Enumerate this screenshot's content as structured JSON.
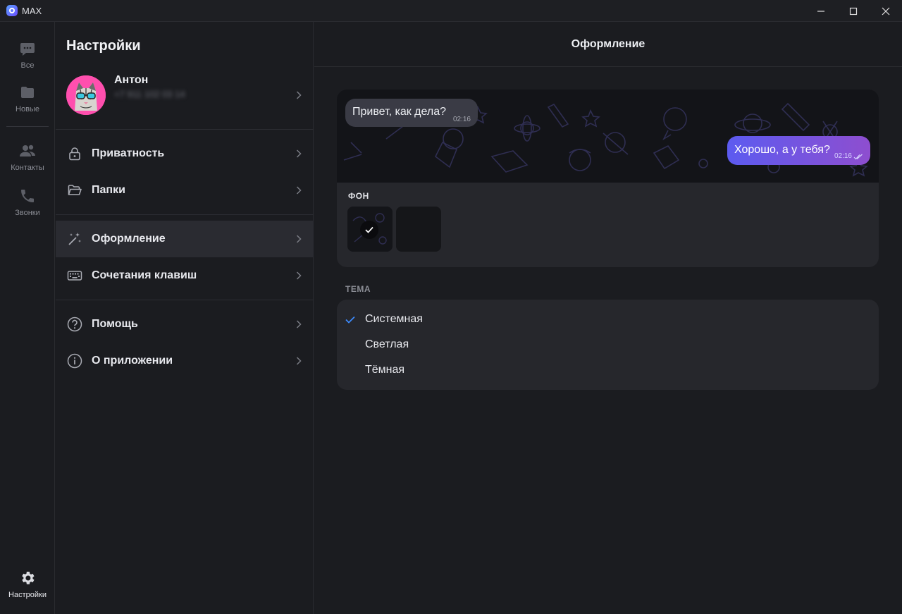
{
  "window": {
    "title": "MAX"
  },
  "rail": {
    "items": [
      {
        "label": "Все",
        "icon": "chat-icon"
      },
      {
        "label": "Новые",
        "icon": "folder-icon"
      },
      {
        "label": "Контакты",
        "icon": "contacts-icon"
      },
      {
        "label": "Звонки",
        "icon": "phone-icon"
      }
    ],
    "settings_label": "Настройки"
  },
  "settings": {
    "title": "Настройки",
    "profile": {
      "name": "Антон",
      "phone": "+7 911 102 03 14"
    },
    "items": [
      {
        "label": "Приватность",
        "icon": "lock-icon"
      },
      {
        "label": "Папки",
        "icon": "folder-open-icon"
      },
      {
        "label": "Оформление",
        "icon": "magic-wand-icon"
      },
      {
        "label": "Сочетания клавиш",
        "icon": "keyboard-icon"
      },
      {
        "label": "Помощь",
        "icon": "help-icon"
      },
      {
        "label": "О приложении",
        "icon": "info-icon"
      }
    ]
  },
  "main": {
    "title": "Оформление",
    "preview": {
      "incoming": {
        "text": "Привет, как дела?",
        "time": "02:16"
      },
      "outgoing": {
        "text": "Хорошо, а у тебя?",
        "time": "02:16"
      }
    },
    "background": {
      "label": "ФОН"
    },
    "theme": {
      "label": "ТЕМА",
      "options": [
        "Системная",
        "Светлая",
        "Тёмная"
      ],
      "selected": "Системная"
    }
  },
  "colors": {
    "accent": "#5c5bf0",
    "accent_2": "#8e4ecf",
    "check_blue": "#3d8bff",
    "panel": "#26272c",
    "background": "#1b1c20"
  }
}
